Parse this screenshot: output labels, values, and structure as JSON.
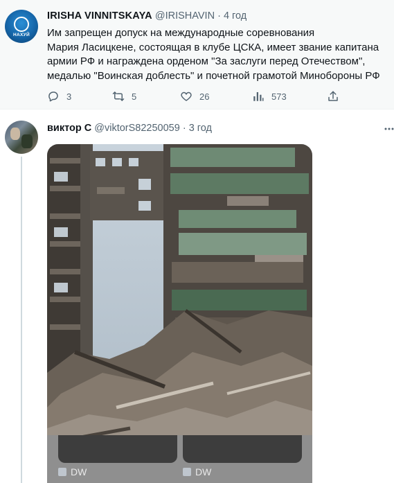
{
  "tweet1": {
    "author_name": "IRISHA VINNITSKAYA",
    "handle": "@IRISHAVIN",
    "separator": "·",
    "time": "4 год",
    "avatar_logo_text": "НАХУЙ",
    "text_lines": [
      "Им запрещен допуск на международные соревнования",
      "Мария Ласицкене, состоящая в клубе ЦСКА, имеет звание капитана",
      "армии РФ и награждена орденом \"За заслуги перед Отечеством\",",
      "медалью \"Воинская доблесть\" и почетной грамотой Минобороны РФ"
    ],
    "actions": {
      "reply_count": "3",
      "retweet_count": "5",
      "like_count": "26",
      "views_count": "573"
    }
  },
  "tweet2": {
    "author_name": "виктор С",
    "handle": "@viktorS82250059",
    "separator": "·",
    "time": "3 год",
    "cards": [
      {
        "label": "DW"
      },
      {
        "label": "DW"
      }
    ]
  },
  "icons": {
    "reply": "reply-icon",
    "retweet": "retweet-icon",
    "like": "heart-icon",
    "views": "analytics-icon",
    "share": "share-icon",
    "more": "more-icon",
    "card_source": "dw-icon"
  },
  "colors": {
    "secondary_text": "#536471",
    "thread_line": "#cfd9de",
    "highlight_bg": "#f7f9f9"
  }
}
